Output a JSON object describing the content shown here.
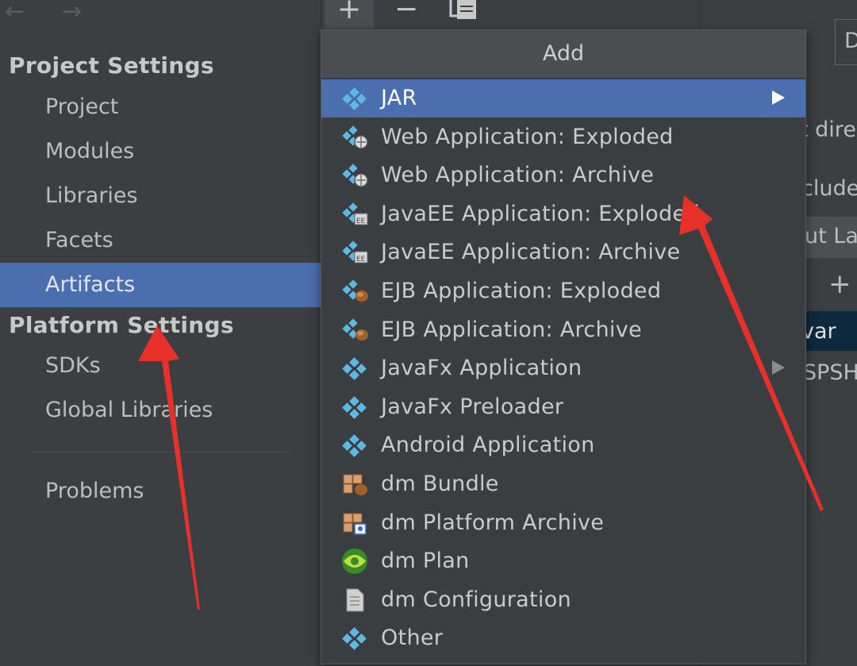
{
  "nav": {
    "back_arrow": "←",
    "forward_arrow": "→",
    "project_settings_title": "Project Settings",
    "project_items": [
      "Project",
      "Modules",
      "Libraries",
      "Facets",
      "Artifacts"
    ],
    "selected_item": "Artifacts",
    "platform_settings_title": "Platform Settings",
    "platform_items": [
      "SDKs",
      "Global Libraries"
    ],
    "problems": "Problems"
  },
  "toolbar": {
    "add_label": "+",
    "remove_label": "−"
  },
  "popup": {
    "title": "Add",
    "items": [
      {
        "label": "JAR",
        "icon": "artifact-diamond-icon",
        "submenu": true,
        "selected": true
      },
      {
        "label": "Web Application: Exploded",
        "icon": "web-app-icon"
      },
      {
        "label": "Web Application: Archive",
        "icon": "web-app-icon"
      },
      {
        "label": "JavaEE Application: Exploded",
        "icon": "javaee-app-icon"
      },
      {
        "label": "JavaEE Application: Archive",
        "icon": "javaee-app-icon"
      },
      {
        "label": "EJB Application: Exploded",
        "icon": "ejb-app-icon"
      },
      {
        "label": "EJB Application: Archive",
        "icon": "ejb-app-icon"
      },
      {
        "label": "JavaFx Application",
        "icon": "artifact-diamond-icon",
        "submenu": true
      },
      {
        "label": "JavaFx Preloader",
        "icon": "artifact-diamond-icon"
      },
      {
        "label": "Android Application",
        "icon": "artifact-diamond-icon"
      },
      {
        "label": "dm Bundle",
        "icon": "dm-bundle-icon"
      },
      {
        "label": "dm Platform Archive",
        "icon": "dm-platform-icon"
      },
      {
        "label": "dm Plan",
        "icon": "dm-plan-icon"
      },
      {
        "label": "dm Configuration",
        "icon": "dm-config-icon"
      },
      {
        "label": "Other",
        "icon": "artifact-diamond-icon"
      }
    ]
  },
  "right_pane": {
    "fragments": [
      "D",
      "t dire",
      "clude",
      "ut La",
      "+",
      "var",
      "SPSH"
    ]
  },
  "colors": {
    "selection": "#4b6eaf",
    "background": "#3c3f41",
    "annotation": "#e8302a"
  }
}
